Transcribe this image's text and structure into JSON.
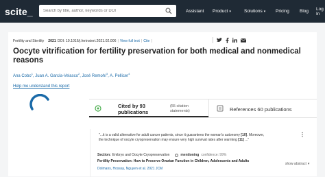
{
  "header": {
    "logo": "scite_",
    "search_placeholder": "Search by title, author, keywords or DOI",
    "nav": {
      "assistant": "Assistant",
      "product": "Product",
      "solutions": "Solutions",
      "pricing": "Pricing",
      "blog": "Blog",
      "log_in": "Log In"
    }
  },
  "paper": {
    "journal": "Fertility and Sterility",
    "year": "2021",
    "doi": "DOI: 10.1016/j.fertnstert.2021.02.006",
    "view_full_text": "View full text",
    "cite": "Cite",
    "title": "Oocyte vitrification for fertility preservation for both medical and nonmedical reasons",
    "authors": [
      {
        "name": "Ana Cobo",
        "sup": "1"
      },
      {
        "name": "Juan A. García-Velasco",
        "sup": "2"
      },
      {
        "name": "José Remohí",
        "sup": "3"
      },
      {
        "name": "A. Pellicer",
        "sup": "4"
      }
    ],
    "help_link": "Help me understand this report"
  },
  "tabs": {
    "cited_by": "Cited by 93 publications",
    "cited_by_sub": "(55 citation statements)",
    "references": "References 60 publications"
  },
  "citation": {
    "quote_prefix": "\"...it is a valid alternative for adult cancer patients, since it guarantees the woman's autonomy ",
    "ref1": "[10]",
    "quote_mid": ". Moreover, the technique of oocyte cryopreservation may ensure very high survival rates after warming ",
    "ref2": "[11]",
    "quote_suffix": " ...\"",
    "section_label": "Section:",
    "section_value": "Embryo and Oocyte Cryopreservation",
    "mentioning": "mentioning",
    "confidence": "confidence: 99%",
    "ref_title": "Fertility Preservation: How to Preserve Ovarian Function in Children, Adolescents and Adults",
    "ref_authors": "Dolmans, Hossay, Nguyen et al. 2021 JCM",
    "show_abstract": "show abstract"
  }
}
